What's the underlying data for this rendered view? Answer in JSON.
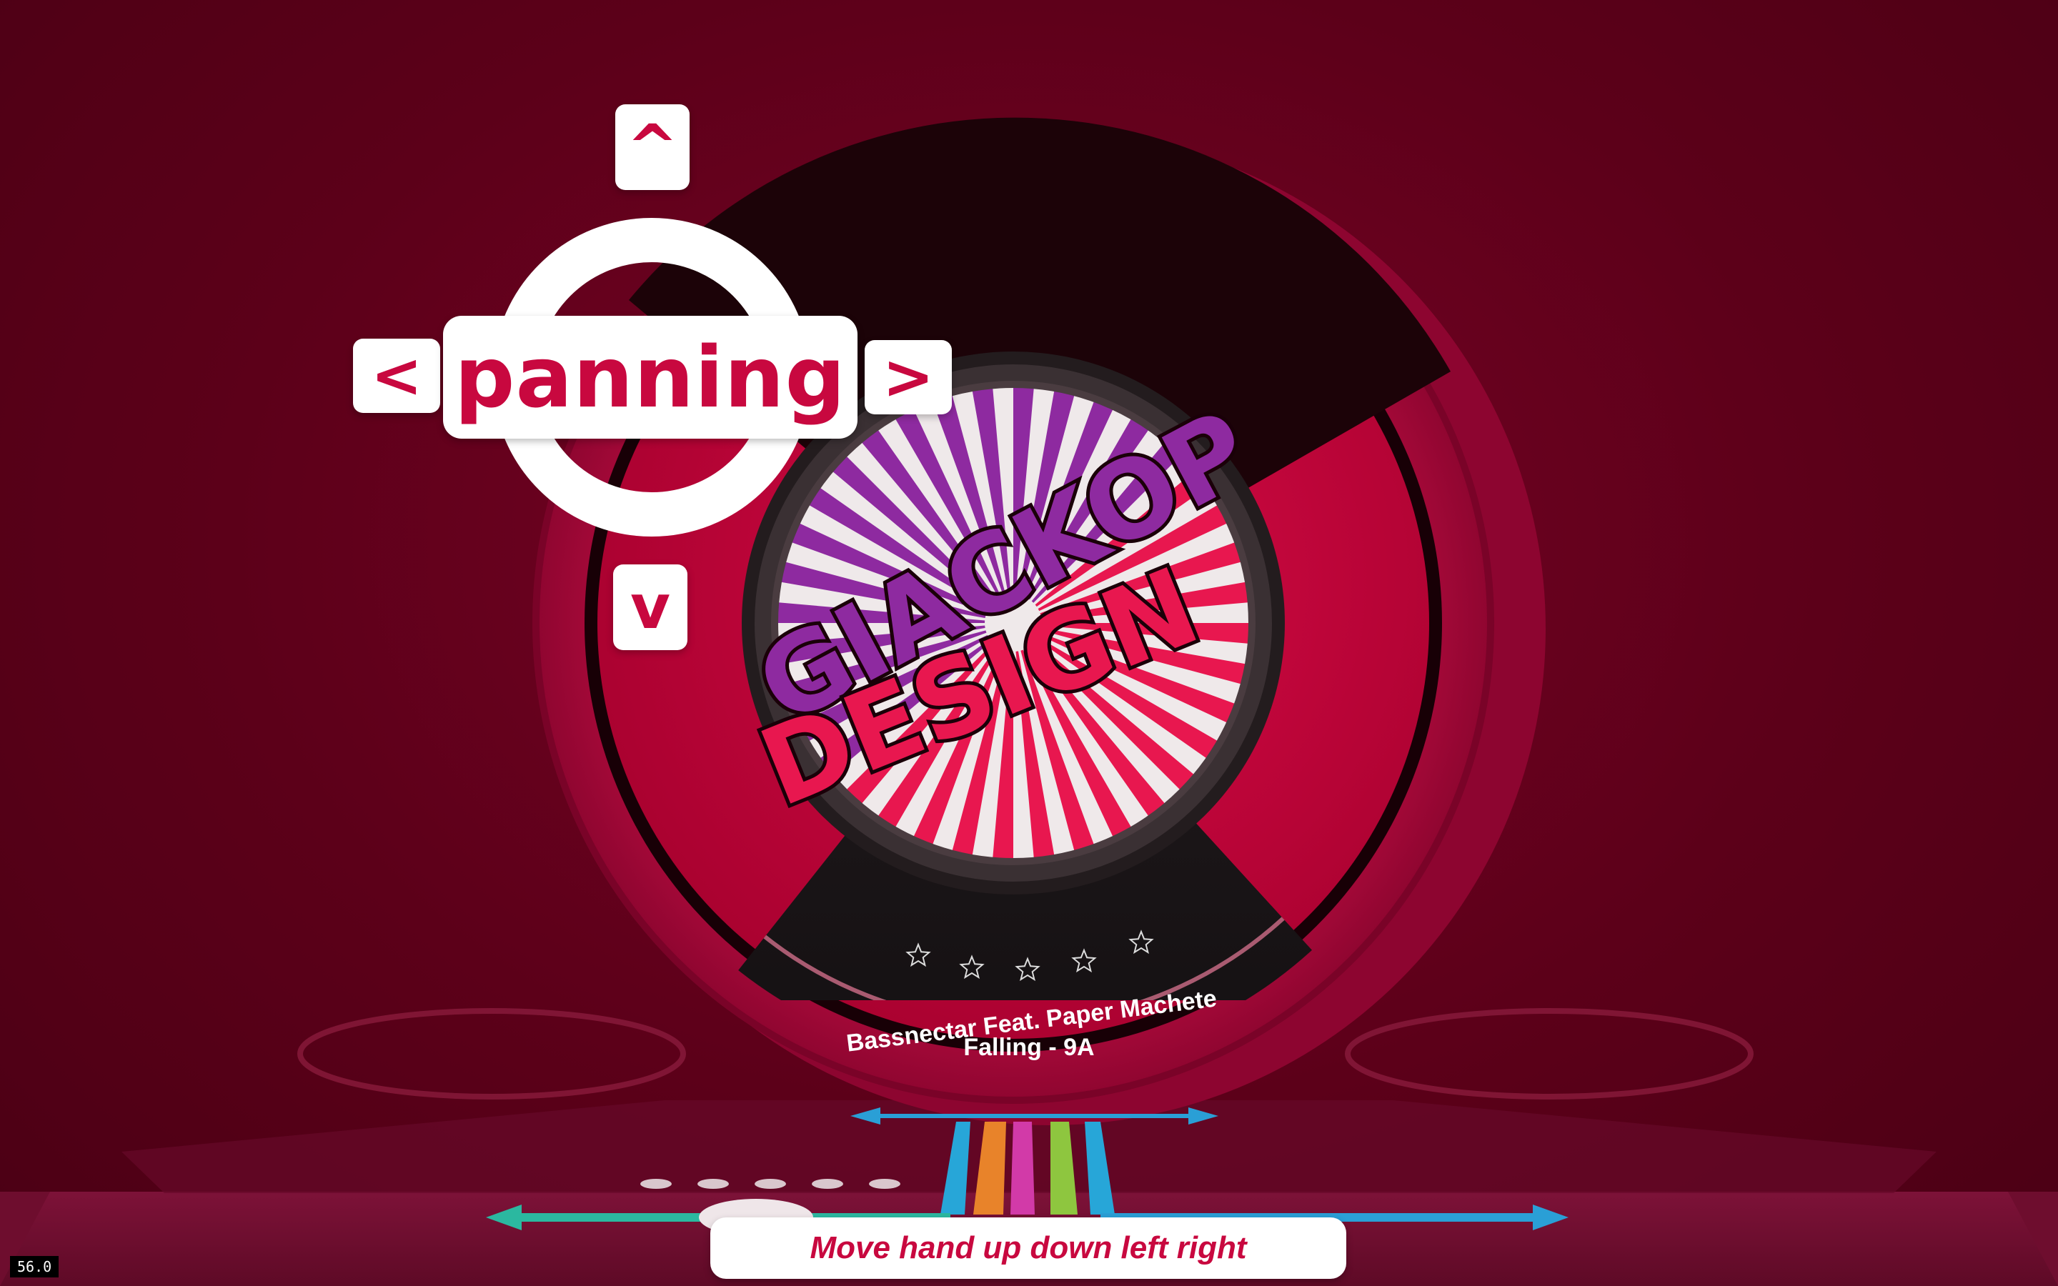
{
  "hud": {
    "mode_label": "panning",
    "up_label": "^",
    "down_label": "v",
    "left_label": "<",
    "right_label": ">"
  },
  "track": {
    "artist": "Bassnectar Feat. Paper Machete",
    "title_key": "Falling - 9A",
    "rating": 0,
    "rating_max": 5
  },
  "logo": {
    "line1": "GIACKOP",
    "line2": "DESIGN"
  },
  "instruction": "Move hand up down left right",
  "fps": "56.0",
  "colors": {
    "background": "#5c0019",
    "accent": "#c8083f",
    "logo_pink": "#e8174f",
    "logo_purple": "#8e2aa0",
    "stripe_blue": "#27a6d8",
    "stripe_orange": "#e8832a",
    "stripe_magenta": "#d23aa8",
    "stripe_green": "#8ec63f",
    "arrow_teal": "#2bb8a0",
    "arrow_blue": "#2a9fd6"
  },
  "icons": {
    "up": "chevron-up-icon",
    "down": "chevron-down-icon",
    "left": "chevron-left-icon",
    "right": "chevron-right-icon",
    "star": "star-outline-icon"
  }
}
